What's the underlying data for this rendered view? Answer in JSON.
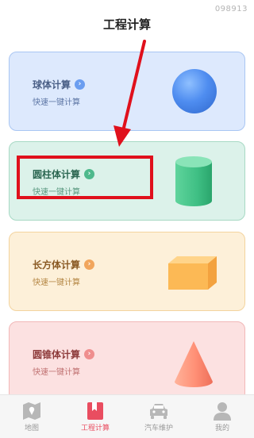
{
  "watermark": "098913",
  "page_title": "工程计算",
  "cards": [
    {
      "title": "球体计算",
      "subtitle": "快速一键计算",
      "shape": "sphere-icon"
    },
    {
      "title": "圆柱体计算",
      "subtitle": "快速一键计算",
      "shape": "cylinder-icon"
    },
    {
      "title": "长方体计算",
      "subtitle": "快速一键计算",
      "shape": "cuboid-icon"
    },
    {
      "title": "圆锥体计算",
      "subtitle": "快速一键计算",
      "shape": "cone-icon"
    }
  ],
  "tabs": [
    {
      "label": "地图",
      "icon": "map-icon",
      "active": false
    },
    {
      "label": "工程计算",
      "icon": "bookmark-icon",
      "active": true
    },
    {
      "label": "汽车维护",
      "icon": "car-icon",
      "active": false
    },
    {
      "label": "我的",
      "icon": "user-icon",
      "active": false
    }
  ],
  "colors": {
    "accent": "#e94d60",
    "annotation_red": "#e0101c"
  }
}
